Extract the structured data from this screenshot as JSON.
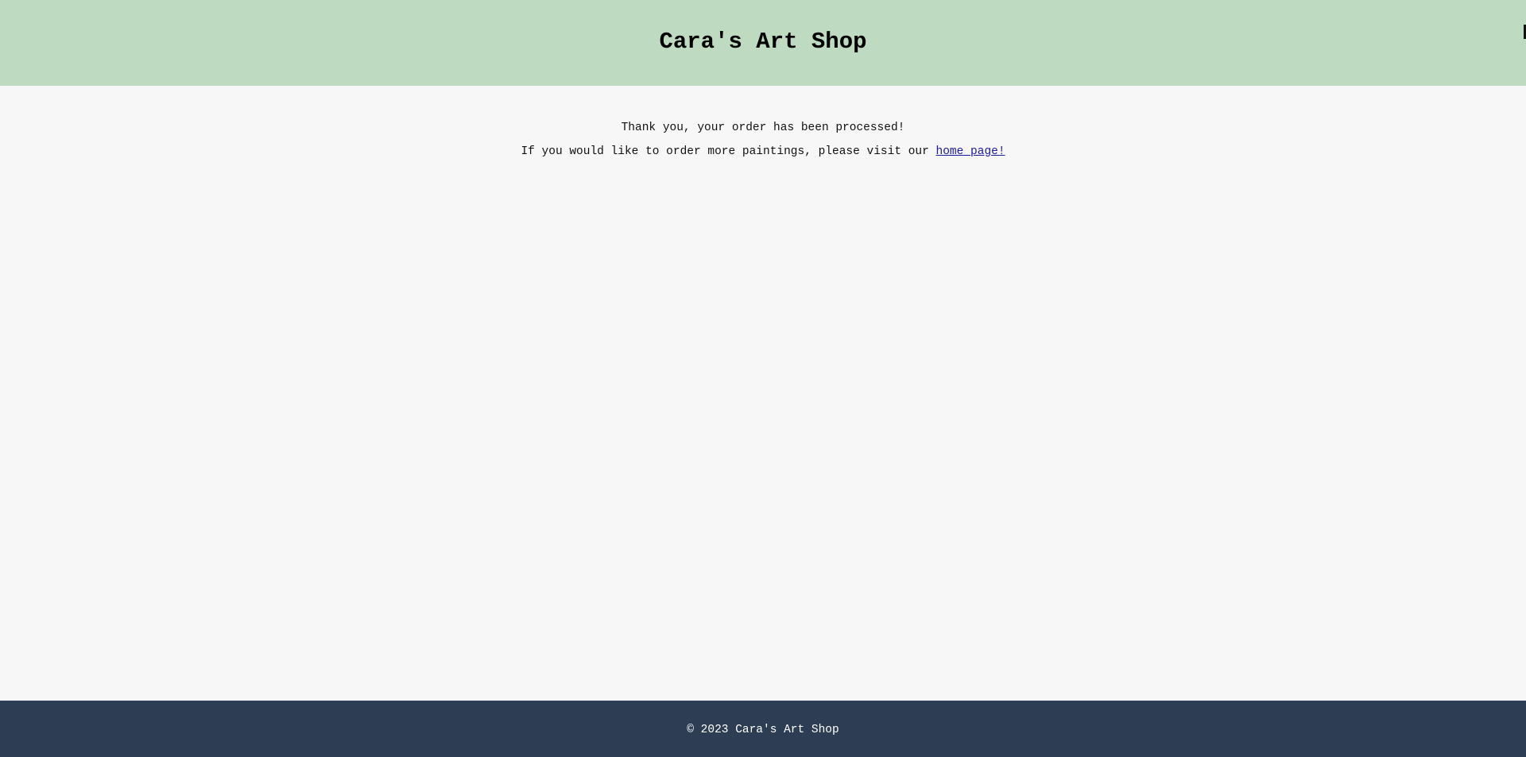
{
  "header": {
    "title": "Cara's Art Shop"
  },
  "main": {
    "thank_you": "Thank you, your order has been processed!",
    "more_prefix": "If you would like to order more paintings, please visit our ",
    "home_link_label": "home page!"
  },
  "footer": {
    "copyright": "© 2023 Cara's Art Shop"
  },
  "colors": {
    "header_bg": "#bedac0",
    "page_bg": "#f7f7f7",
    "footer_bg": "#2d3e54",
    "link": "#1a1aa6"
  }
}
